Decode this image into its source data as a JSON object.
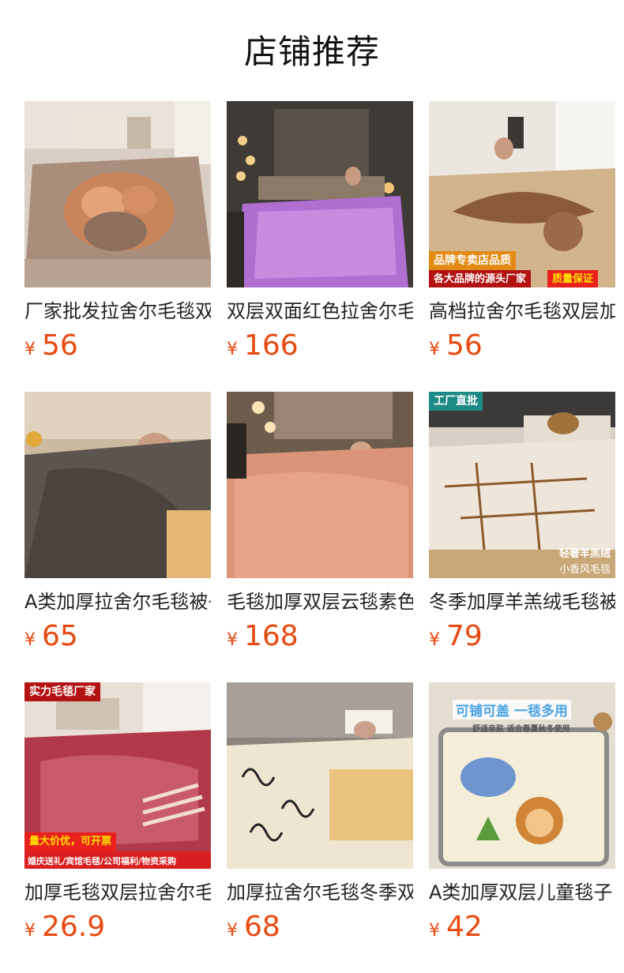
{
  "header": {
    "title": "店铺推荐"
  },
  "currency_symbol": "¥",
  "products": [
    {
      "name": "厂家批发拉舍尔毛毯双层加厚",
      "price": "56",
      "badges": []
    },
    {
      "name": "双层双面红色拉舍尔毛毯",
      "price": "166",
      "badges": []
    },
    {
      "name": "高档拉舍尔毛毯双层加厚",
      "price": "56",
      "badges": [
        "品牌专卖店品质",
        "各大品牌的源头厂家",
        "质量保证"
      ]
    },
    {
      "name": "A类加厚拉舍尔毛毯被子",
      "price": "65",
      "badges": []
    },
    {
      "name": "毛毯加厚双层云毯素色",
      "price": "168",
      "badges": []
    },
    {
      "name": "冬季加厚羊羔绒毛毯被子",
      "price": "79",
      "badges": [
        "工厂直批",
        "轻奢羊羔绒",
        "小香风毛毯"
      ]
    },
    {
      "name": "加厚毛毯双层拉舍尔毛毯",
      "price": "26.9",
      "badges": [
        "实力毛毯厂家",
        "量大价优，可开票",
        "婚庆送礼/宾馆毛毯/公司福利/物资采购"
      ]
    },
    {
      "name": "加厚拉舍尔毛毯冬季双层",
      "price": "68",
      "badges": []
    },
    {
      "name": "A类加厚双层儿童毯子",
      "price": "42",
      "badges": [
        "可铺可盖 一毯多用",
        "舒适亲肤 适合春夏秋冬使用"
      ]
    }
  ],
  "colors": {
    "price": "#e8490f",
    "title": "#111111",
    "name": "#222222"
  }
}
